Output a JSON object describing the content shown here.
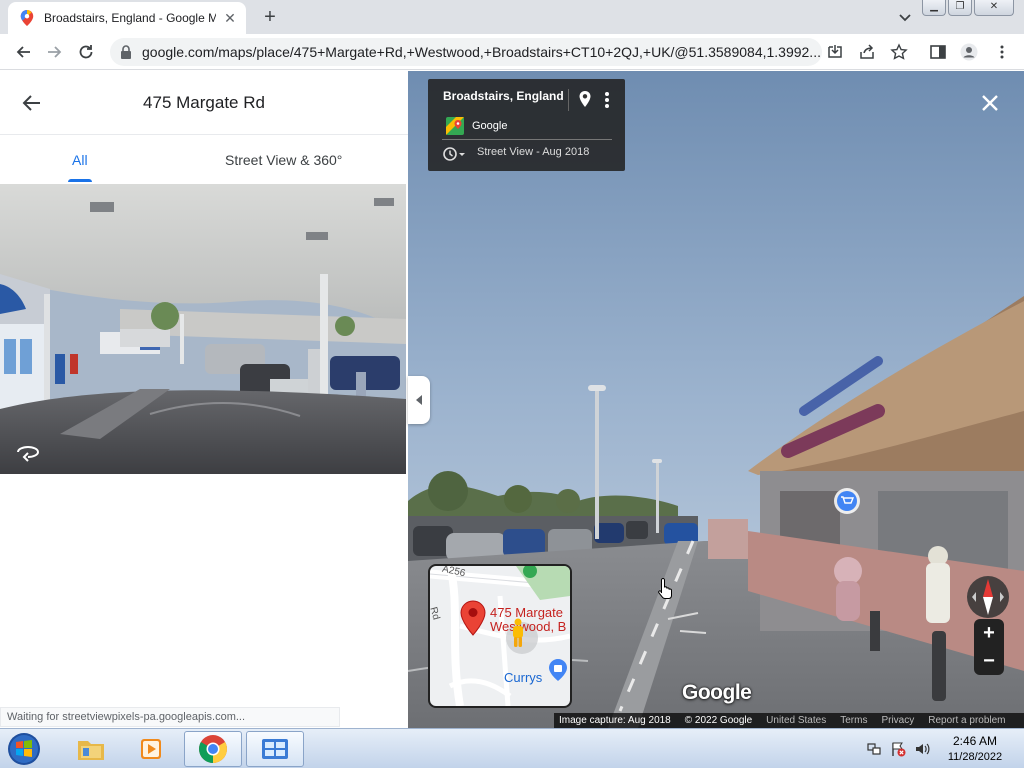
{
  "browser": {
    "tab_title": "Broadstairs, England - Google Ma",
    "url": "google.com/maps/place/475+Margate+Rd,+Westwood,+Broadstairs+CT10+2QJ,+UK/@51.3589084,1.3992..."
  },
  "left_panel": {
    "title": "475 Margate Rd",
    "tabs": [
      {
        "label": "All",
        "active": true
      },
      {
        "label": "Street View & 360°",
        "active": false
      }
    ],
    "status_text": "Waiting for streetviewpixels-pa.googleapis.com..."
  },
  "street_view": {
    "place_name": "Broadstairs, England",
    "provider": "Google",
    "capture_label": "Street View - Aug 2018",
    "minimap": {
      "road_a": "A256",
      "road_b": "Rd",
      "address_line1": "475 Margate",
      "address_line2": "Westwood, B",
      "poi": "Currys"
    },
    "watermark": "Google",
    "footer": {
      "image_capture": "Image capture: Aug 2018",
      "copyright": "© 2022 Google",
      "links": [
        "United States",
        "Terms",
        "Privacy",
        "Report a problem"
      ]
    },
    "zoom_in": "+",
    "zoom_out": "−"
  },
  "taskbar": {
    "time": "2:46 AM",
    "date": "11/28/2022"
  },
  "colors": {
    "accent": "#1a73e8",
    "pin_red": "#ea4335",
    "info_card_bg": "#222222"
  }
}
